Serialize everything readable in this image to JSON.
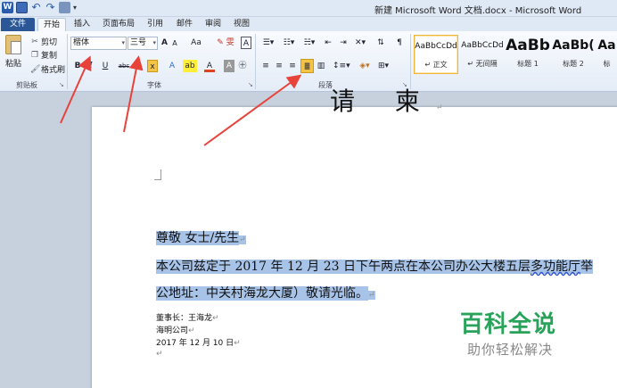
{
  "window": {
    "title": "新建 Microsoft Word 文档.docx - Microsoft Word"
  },
  "qat": {
    "app_icon": "word-icon",
    "more": "▾"
  },
  "tabs": [
    "文件",
    "开始",
    "插入",
    "页面布局",
    "引用",
    "邮件",
    "审阅",
    "视图"
  ],
  "clipboard": {
    "paste": "粘贴",
    "cut": "剪切",
    "copy": "复制",
    "format_painter": "格式刷",
    "group": "剪贴板"
  },
  "font": {
    "name": "楷体",
    "size": "三号",
    "group": "字体",
    "grow": "A",
    "shrink": "A",
    "case": "Aa",
    "bold": "B",
    "italic": "I",
    "underline": "U",
    "strike": "abc",
    "subscript": "x",
    "superscript": "x"
  },
  "paragraph": {
    "group": "段落",
    "justify_active": true
  },
  "styles": [
    {
      "preview": "AaBbCcDd",
      "name": "↵ 正文"
    },
    {
      "preview": "AaBbCcDd",
      "name": "↵ 无间隔"
    },
    {
      "preview": "AaBb",
      "name": "标题 1"
    },
    {
      "preview": "AaBb(",
      "name": "标题 2"
    },
    {
      "preview": "Aa",
      "name": "标"
    }
  ],
  "document": {
    "title": "请 柬",
    "line1": "尊敬    女士/先生",
    "line2_a": "本公司兹定于 2017 年 12 月 23 日下午两点在本公司办公大楼五层",
    "line2_b": "多功能厅",
    "line2_c": "举",
    "line3": "公地址：中关村海龙大厦）敬请光临。",
    "sign1": "董事长：王海龙",
    "sign2": "海明公司",
    "sign3": "2017 年 12 月 10 日",
    "para_mark": "↵"
  },
  "watermark": {
    "main": "百科全说",
    "sub": "助你轻松解决"
  },
  "colors": {
    "file_tab": "#2b5797",
    "selection": "#a7c3e8",
    "arrow": "#e8433a",
    "watermark_green": "#29a35a"
  }
}
